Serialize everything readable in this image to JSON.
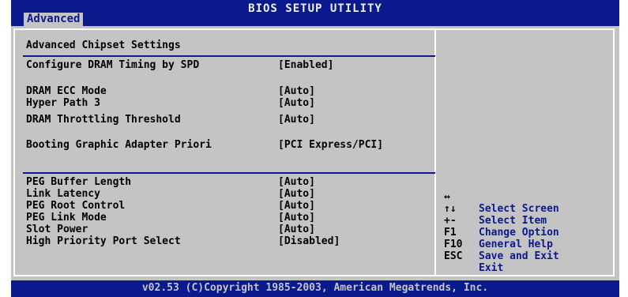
{
  "window": {
    "title": "BIOS SETUP UTILITY",
    "active_tab": "Advanced"
  },
  "section_title": "Advanced Chipset Settings",
  "settings": [
    {
      "label": "Configure DRAM Timing by SPD",
      "value": "[Enabled]"
    },
    {
      "label": "DRAM ECC Mode",
      "value": "[Auto]"
    },
    {
      "label": "Hyper Path 3",
      "value": "[Auto]"
    },
    {
      "label": "DRAM Throttling Threshold",
      "value": "[Auto]"
    },
    {
      "label": "Booting Graphic Adapter Priori",
      "value": "[PCI Express/PCI]"
    },
    {
      "label": "PEG Buffer Length",
      "value": "[Auto]"
    },
    {
      "label": "Link Latency",
      "value": "[Auto]"
    },
    {
      "label": "PEG Root Control",
      "value": "[Auto]"
    },
    {
      "label": "PEG Link Mode",
      "value": "[Auto]"
    },
    {
      "label": "Slot Power",
      "value": "[Auto]"
    },
    {
      "label": "High Priority Port Select",
      "value": "[Disabled]"
    }
  ],
  "help": [
    {
      "key": "↔",
      "desc": "Select Screen"
    },
    {
      "key": "↑↓",
      "desc": "Select Item"
    },
    {
      "key": "+-",
      "desc": "Change Option"
    },
    {
      "key": "F1",
      "desc": "General Help"
    },
    {
      "key": "F10",
      "desc": "Save and Exit"
    },
    {
      "key": "ESC",
      "desc": "Exit"
    }
  ],
  "footer": "v02.53 (C)Copyright 1985-2003, American Megatrends, Inc.",
  "colors": {
    "bar": "#0a1a8c",
    "panel": "#c4c4c4",
    "border": "#ffffff"
  }
}
